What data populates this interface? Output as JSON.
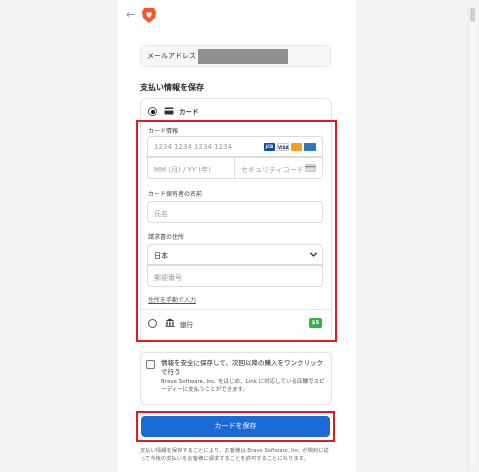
{
  "header": {
    "back_icon": "back-arrow-icon",
    "logo_icon": "brave-lion-icon"
  },
  "email": {
    "label": "メールアドレス"
  },
  "payment": {
    "section_title": "支払い情報を保存",
    "card_option_label": "カード",
    "card_info_label": "カード情報",
    "card_number_placeholder": "1234 1234 1234 1234",
    "brands": [
      "JCB",
      "VISA",
      "MC",
      "AMEX"
    ],
    "expiry_placeholder": "MM (月) / YY (年)",
    "cvc_placeholder": "セキュリティコード",
    "cardholder_label": "カード保有者の名前",
    "cardholder_placeholder": "氏名",
    "billing_label": "請求書の住所",
    "country_value": "日本",
    "postal_placeholder": "郵便番号",
    "manual_address_link": "住所を手動で入力",
    "bank_option_label": "銀行",
    "bank_badge": "$5"
  },
  "save_info": {
    "title": "情報を安全に保存して、次回以降の購入をワンクリックで行う",
    "description": "Brave Software, Inc. をはじめ、Link に対応している店舗でスピーディーに支払うことができます。"
  },
  "submit_button": "カードを保存",
  "footer_note": "支払い情報を保存することにより、お客様は Brave Software, Inc. が規約に従って今後の支払いをお客様に請求することを許可することになります。",
  "colors": {
    "accent": "#1b6ad8",
    "highlight": "#e01b24",
    "badge": "#33b249"
  }
}
